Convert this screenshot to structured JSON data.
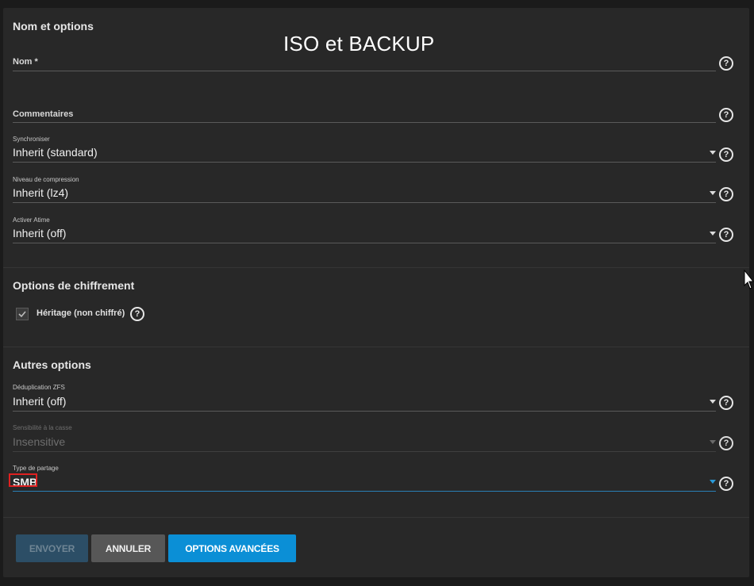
{
  "annotation": "ISO et BACKUP",
  "sections": {
    "name_options": "Nom et options",
    "encryption": "Options de chiffrement",
    "other": "Autres options"
  },
  "fields": {
    "name": {
      "label": "Nom *",
      "value": ""
    },
    "comments": {
      "label": "Commentaires",
      "value": ""
    },
    "sync": {
      "label": "Synchroniser",
      "value": "Inherit (standard)"
    },
    "compression": {
      "label": "Niveau de compression",
      "value": "Inherit (lz4)"
    },
    "atime": {
      "label": "Activer Atime",
      "value": "Inherit (off)"
    },
    "dedup": {
      "label": "Déduplication ZFS",
      "value": "Inherit (off)"
    },
    "case": {
      "label": "Sensibilité à la casse",
      "value": "Insensitive"
    },
    "share_type": {
      "label": "Type de partage",
      "value": "SMB"
    }
  },
  "encryption": {
    "inherit_label": "Héritage (non chiffré)",
    "inherit_checked": true
  },
  "help_glyph": "?",
  "buttons": {
    "submit": "ENVOYER",
    "cancel": "ANNULER",
    "advanced": "OPTIONS AVANCÉES"
  },
  "colors": {
    "accent": "#0b8fd6",
    "highlight": "#e02020",
    "background": "#282828"
  }
}
